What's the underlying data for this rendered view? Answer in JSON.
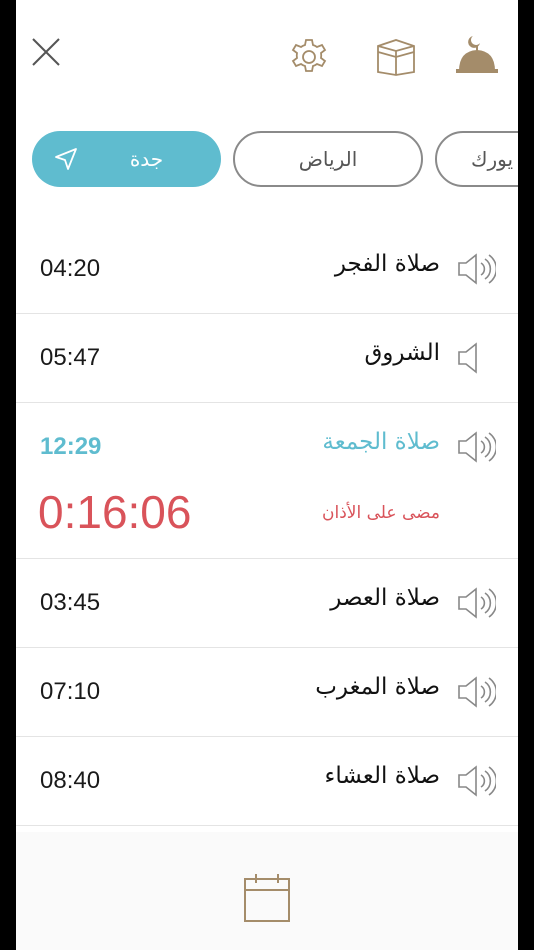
{
  "topbar": {
    "icons": [
      "close-icon",
      "settings-icon",
      "kaaba-icon",
      "mosque-icon"
    ]
  },
  "cities": [
    {
      "label": "جدة",
      "active": true
    },
    {
      "label": "الرياض",
      "active": false
    },
    {
      "label": "يورك",
      "active": false
    }
  ],
  "prayers": [
    {
      "name": "صلاة الفجر",
      "time": "04:20",
      "sound": "on"
    },
    {
      "name": "الشروق",
      "time": "05:47",
      "sound": "off"
    },
    {
      "name": "صلاة الجمعة",
      "time": "12:29",
      "sound": "on",
      "active": true
    },
    {
      "name": "صلاة العصر",
      "time": "03:45",
      "sound": "on"
    },
    {
      "name": "صلاة المغرب",
      "time": "07:10",
      "sound": "on"
    },
    {
      "name": "صلاة العشاء",
      "time": "08:40",
      "sound": "on"
    }
  ],
  "countdown": {
    "value": "0:16:06",
    "label": "مضى على الأذان"
  },
  "colors": {
    "accent": "#5fbccf",
    "alert": "#d9535a",
    "icon": "#a48c6a",
    "text": "#111111"
  }
}
